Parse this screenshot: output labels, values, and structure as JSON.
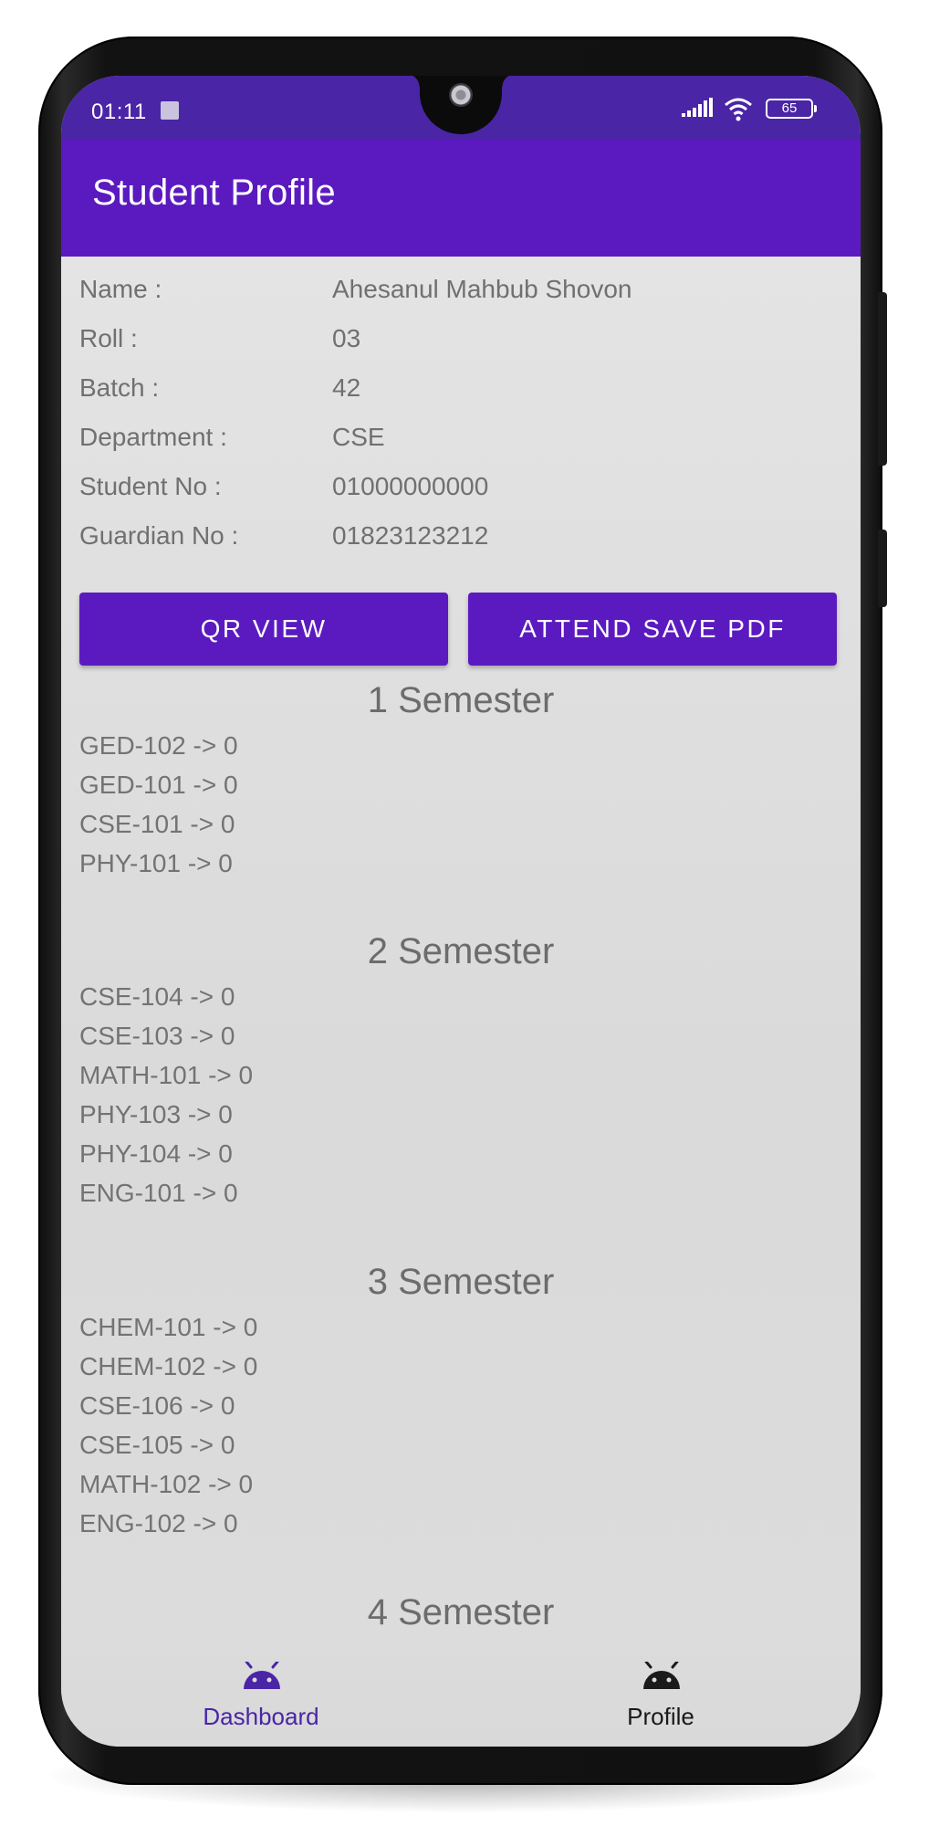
{
  "status_bar": {
    "time": "01:11",
    "battery": "65"
  },
  "app_bar": {
    "title": "Student Profile"
  },
  "profile": [
    {
      "label": "Name :",
      "value": "Ahesanul Mahbub Shovon"
    },
    {
      "label": "Roll :",
      "value": "03"
    },
    {
      "label": "Batch :",
      "value": "42"
    },
    {
      "label": "Department :",
      "value": "CSE"
    },
    {
      "label": "Student No :",
      "value": "01000000000"
    },
    {
      "label": "Guardian No :",
      "value": "01823123212"
    }
  ],
  "actions": {
    "qr_view": "QR VIEW",
    "attend_save_pdf": "ATTEND SAVE PDF"
  },
  "semesters": [
    {
      "title": "1 Semester",
      "courses": [
        "GED-102 -> 0",
        "GED-101 -> 0",
        "CSE-101 -> 0",
        "PHY-101 -> 0"
      ]
    },
    {
      "title": "2 Semester",
      "courses": [
        "CSE-104 -> 0",
        "CSE-103 -> 0",
        "MATH-101 -> 0",
        "PHY-103 -> 0",
        "PHY-104 -> 0",
        "ENG-101 -> 0"
      ]
    },
    {
      "title": "3 Semester",
      "courses": [
        "CHEM-101 -> 0",
        "CHEM-102 -> 0",
        "CSE-106 -> 0",
        "CSE-105 -> 0",
        "MATH-102 -> 0",
        "ENG-102 -> 0"
      ]
    },
    {
      "title": "4 Semester",
      "courses": []
    }
  ],
  "bottom_nav": {
    "items": [
      {
        "label": "Dashboard",
        "icon": "android-icon",
        "active": true
      },
      {
        "label": "Profile",
        "icon": "android-icon",
        "active": false
      }
    ]
  },
  "colors": {
    "primary": "#5b1ac0",
    "status_bar": "#4a25a6",
    "nav_active": "#4a25a6",
    "nav_inactive": "#1a1a1a"
  }
}
